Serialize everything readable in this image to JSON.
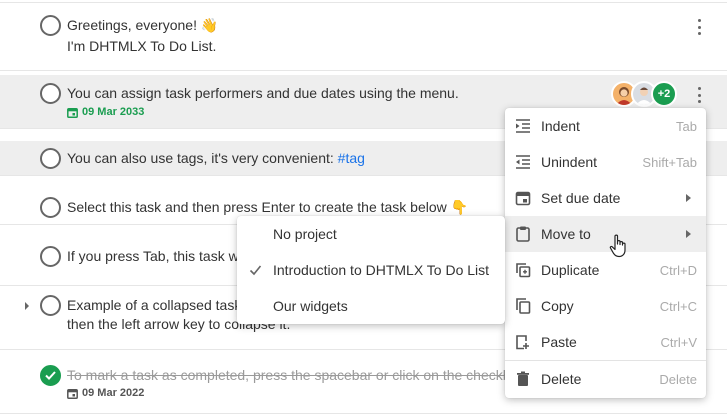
{
  "tasks": [
    {
      "line1": "Greetings, everyone! ",
      "emoji": "👋",
      "line2": "I'm DHTMLX To Do List."
    },
    {
      "text": "You can assign task performers and due dates using the menu.",
      "date": "09 Mar 2033",
      "assignees_more": "+2"
    },
    {
      "text": "You can also use tags, it's very convenient: ",
      "tag": "#tag"
    },
    {
      "text": "Select this task and then press Enter to create the task below ",
      "emoji": "👇"
    },
    {
      "text": "If you press Tab, this task w"
    },
    {
      "line1": "Example of a collapsed task",
      "line2": "then the left arrow key to collapse it."
    },
    {
      "text": "To mark a task as completed, press the spacebar or click on the checkb",
      "date": "09 Mar 2022"
    }
  ],
  "context_menu": {
    "items": [
      {
        "label": "Indent",
        "shortcut": "Tab",
        "icon": "indent-icon"
      },
      {
        "label": "Unindent",
        "shortcut": "Shift+Tab",
        "icon": "unindent-icon"
      },
      {
        "label": "Set due date",
        "icon": "calendar-icon",
        "submenu": true
      },
      {
        "label": "Move to",
        "icon": "clipboard-icon",
        "submenu": true,
        "active": true
      },
      {
        "label": "Duplicate",
        "shortcut": "Ctrl+D",
        "icon": "duplicate-icon"
      },
      {
        "label": "Copy",
        "shortcut": "Ctrl+C",
        "icon": "copy-icon"
      },
      {
        "label": "Paste",
        "shortcut": "Ctrl+V",
        "icon": "paste-icon"
      },
      {
        "label": "Delete",
        "shortcut": "Delete",
        "icon": "trash-icon"
      }
    ]
  },
  "move_to_submenu": {
    "items": [
      {
        "label": "No project",
        "checked": false
      },
      {
        "label": "Introduction to DHTMLX To Do List",
        "checked": true
      },
      {
        "label": "Our widgets",
        "checked": false
      }
    ]
  },
  "colors": {
    "accent_green": "#1a9d50",
    "tag_blue": "#1a73e8",
    "highlight_row": "#eeeeee"
  }
}
